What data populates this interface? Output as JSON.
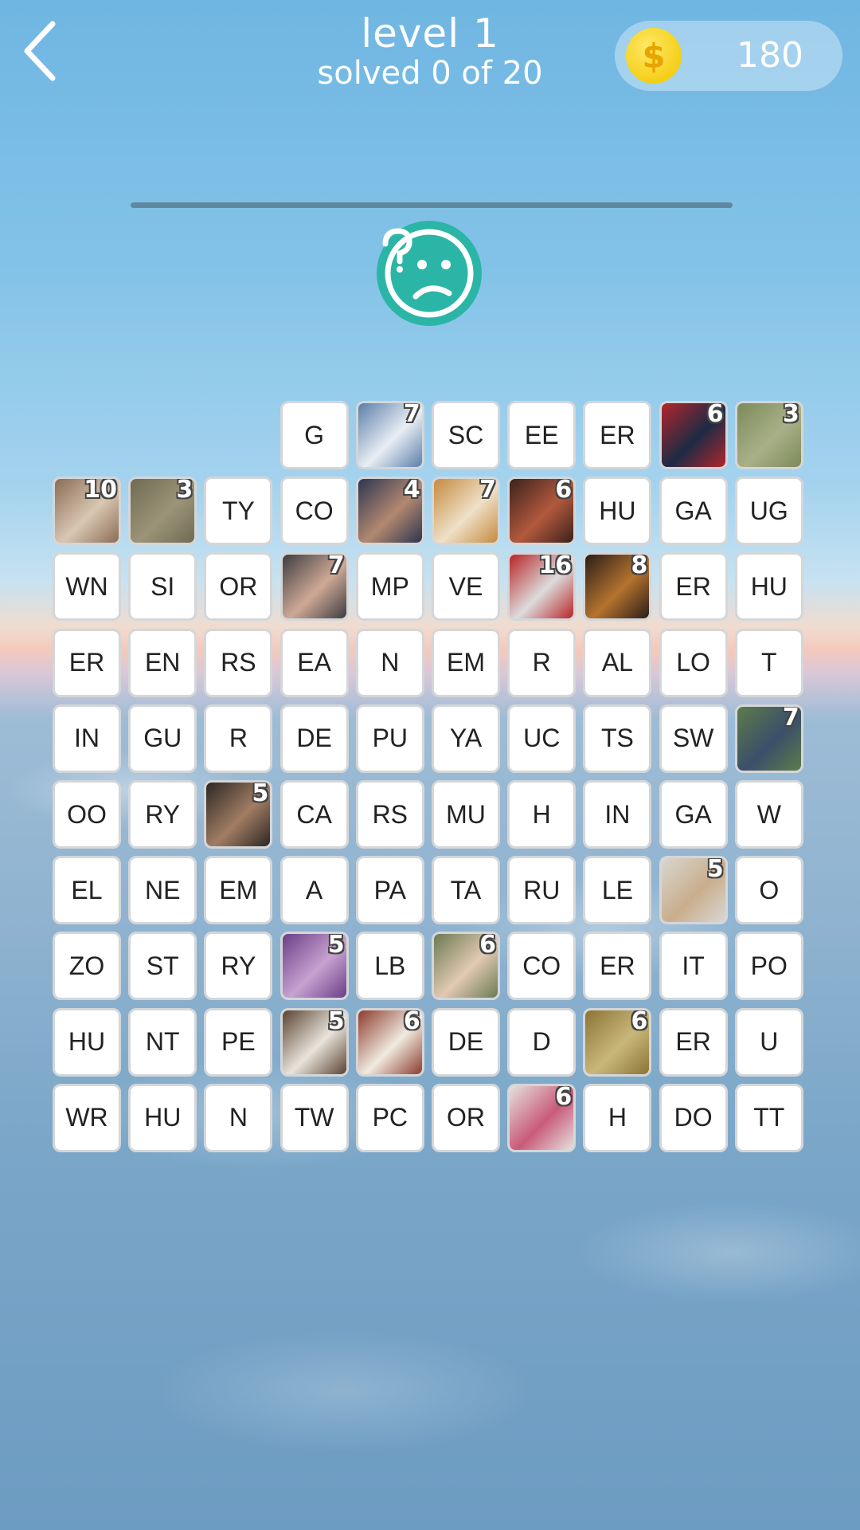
{
  "header": {
    "back_icon": "chevron-left-icon",
    "level_title": "level 1",
    "progress_text": "solved 0 of 20",
    "coins": {
      "icon": "dollar-coin-icon",
      "symbol": "$",
      "count": "180"
    }
  },
  "hint_icon": "confused-face-icon",
  "colors": {
    "accent": "#2bb5a6",
    "coin": "#f4cf18",
    "tile_border": "#d4d6d8"
  },
  "grid": {
    "rows": [
      [
        null,
        null,
        null,
        {
          "text": "G"
        },
        {
          "pic": "snowy mountains",
          "num": "7",
          "colors": [
            "#5b7ea9",
            "#e9eef4"
          ]
        },
        {
          "text": "SC"
        },
        {
          "text": "EE"
        },
        {
          "text": "ER"
        },
        {
          "pic": "costumed people",
          "num": "6",
          "colors": [
            "#b3262c",
            "#1d2b45"
          ]
        },
        {
          "pic": "trees",
          "num": "3",
          "colors": [
            "#7c8a5a",
            "#a9b088"
          ]
        }
      ],
      [
        {
          "pic": "typewriter",
          "num": "10",
          "colors": [
            "#8a6c55",
            "#d9c7b2"
          ]
        },
        {
          "pic": "zebras",
          "num": "3",
          "colors": [
            "#6f6a52",
            "#9c9478"
          ]
        },
        {
          "text": "TY"
        },
        {
          "text": "CO"
        },
        {
          "pic": "thinking man",
          "num": "4",
          "colors": [
            "#2c3550",
            "#b38870"
          ]
        },
        {
          "pic": "corn cob",
          "num": "7",
          "colors": [
            "#c58a3e",
            "#efe0c8"
          ]
        },
        {
          "pic": "hands tattoo",
          "num": "6",
          "colors": [
            "#3b211c",
            "#b3593d"
          ]
        },
        {
          "text": "HU"
        },
        {
          "text": "GA"
        },
        {
          "text": "UG"
        }
      ],
      [
        {
          "text": "WN"
        },
        {
          "text": "SI"
        },
        {
          "text": "OR"
        },
        {
          "pic": "fingers holding",
          "num": "7",
          "colors": [
            "#3c3c40",
            "#cfa996"
          ]
        },
        {
          "text": "MP"
        },
        {
          "text": "VE"
        },
        {
          "pic": "face paint",
          "num": "16",
          "colors": [
            "#b82428",
            "#dcdcdc"
          ]
        },
        {
          "pic": "berries bowl",
          "num": "8",
          "colors": [
            "#2a1d1a",
            "#b5732e"
          ]
        },
        {
          "text": "ER"
        },
        {
          "text": "HU"
        }
      ],
      [
        {
          "text": "ER"
        },
        {
          "text": "EN"
        },
        {
          "text": "RS"
        },
        {
          "text": "EA"
        },
        {
          "text": "N"
        },
        {
          "text": "EM"
        },
        {
          "text": "R"
        },
        {
          "text": "AL"
        },
        {
          "text": "LO"
        },
        {
          "text": "T"
        }
      ],
      [
        {
          "text": "IN"
        },
        {
          "text": "GU"
        },
        {
          "text": "R"
        },
        {
          "text": "DE"
        },
        {
          "text": "PU"
        },
        {
          "text": "YA"
        },
        {
          "text": "UC"
        },
        {
          "text": "TS"
        },
        {
          "text": "SW"
        },
        {
          "pic": "campsite",
          "num": "7",
          "colors": [
            "#5d7c4a",
            "#3a4f6a"
          ]
        }
      ],
      [
        {
          "text": "OO"
        },
        {
          "text": "RY"
        },
        {
          "pic": "couple on couch",
          "num": "5",
          "colors": [
            "#2b2724",
            "#a27d63"
          ]
        },
        {
          "text": "CA"
        },
        {
          "text": "RS"
        },
        {
          "text": "MU"
        },
        {
          "text": "H"
        },
        {
          "text": "IN"
        },
        {
          "text": "GA"
        },
        {
          "text": "W"
        }
      ],
      [
        {
          "text": "EL"
        },
        {
          "text": "NE"
        },
        {
          "text": "EM"
        },
        {
          "text": "A"
        },
        {
          "text": "PA"
        },
        {
          "text": "TA"
        },
        {
          "text": "RU"
        },
        {
          "text": "LE"
        },
        {
          "pic": "child height chart",
          "num": "5",
          "colors": [
            "#d9d6d1",
            "#c9ae8c"
          ]
        },
        {
          "text": "O"
        }
      ],
      [
        {
          "text": "ZO"
        },
        {
          "text": "ST"
        },
        {
          "text": "RY"
        },
        {
          "pic": "organ pipes",
          "num": "5",
          "colors": [
            "#6b3e86",
            "#c7a2d0"
          ]
        },
        {
          "text": "LB"
        },
        {
          "pic": "two girls",
          "num": "6",
          "colors": [
            "#6b7a52",
            "#e2c9b3"
          ]
        },
        {
          "text": "CO"
        },
        {
          "text": "ER"
        },
        {
          "text": "IT"
        },
        {
          "text": "PO"
        }
      ],
      [
        {
          "text": "HU"
        },
        {
          "text": "NT"
        },
        {
          "text": "PE"
        },
        {
          "pic": "scientist",
          "num": "5",
          "colors": [
            "#5a4330",
            "#e9e4dc"
          ]
        },
        {
          "pic": "wall clock",
          "num": "6",
          "colors": [
            "#8c3b2e",
            "#f0eadf"
          ]
        },
        {
          "text": "DE"
        },
        {
          "text": "D"
        },
        {
          "pic": "runner field",
          "num": "6",
          "colors": [
            "#8a7435",
            "#c9b77a"
          ]
        },
        {
          "text": "ER"
        },
        {
          "text": "U"
        }
      ],
      [
        {
          "text": "WR"
        },
        {
          "text": "HU"
        },
        {
          "text": "N"
        },
        {
          "text": "TW"
        },
        {
          "text": "PC"
        },
        {
          "text": "OR"
        },
        {
          "pic": "rainbow pants",
          "num": "6",
          "colors": [
            "#e4e1dd",
            "#c95a7a"
          ]
        },
        {
          "text": "H"
        },
        {
          "text": "DO"
        },
        {
          "text": "TT"
        }
      ]
    ]
  }
}
